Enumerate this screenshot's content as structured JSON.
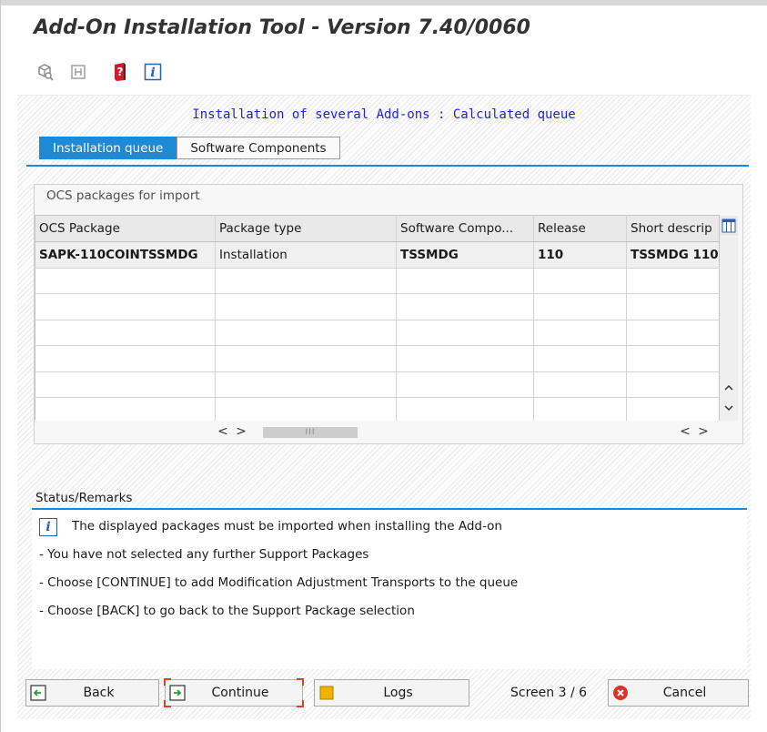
{
  "window": {
    "title": "Add-On Installation Tool - Version 7.40/0060"
  },
  "toolbar": {
    "icons": [
      "cube-search-icon",
      "package-icon",
      "help-icon",
      "info-icon"
    ]
  },
  "header": {
    "subtitle": "Installation of several Add-ons : Calculated queue"
  },
  "tabs": [
    {
      "label": "Installation queue",
      "active": true
    },
    {
      "label": "Software Components",
      "active": false
    }
  ],
  "packages": {
    "group_title": "OCS packages for import",
    "columns": [
      "OCS Package",
      "Package type",
      "Software Compo...",
      "Release",
      "Short descrip"
    ],
    "rows": [
      [
        "SAPK-110COINTSSMDG",
        "Installation",
        "TSSMDG",
        "110",
        "TSSMDG 110"
      ]
    ],
    "empty_rows": 6,
    "scroll": {
      "left": "<",
      "right": ">",
      "up": "^",
      "down": "v",
      "thumb": "III"
    }
  },
  "status": {
    "title": "Status/Remarks",
    "info_icon": "i",
    "lines": [
      "The displayed packages must be imported when installing the Add-on",
      "- You have not selected any further Support Packages",
      "- Choose [CONTINUE] to add Modification Adjustment Transports to the queue",
      "- Choose [BACK] to go back to the Support Package selection"
    ]
  },
  "footer": {
    "back_label": "Back",
    "continue_label": "Continue",
    "logs_label": "Logs",
    "screen_indicator": "Screen 3 / 6",
    "cancel_label": "Cancel"
  },
  "colors": {
    "accent": "#1e8ad6",
    "title_text": "#333333",
    "subtitle_text": "#2222d6",
    "cancel_red": "#d9342b"
  }
}
